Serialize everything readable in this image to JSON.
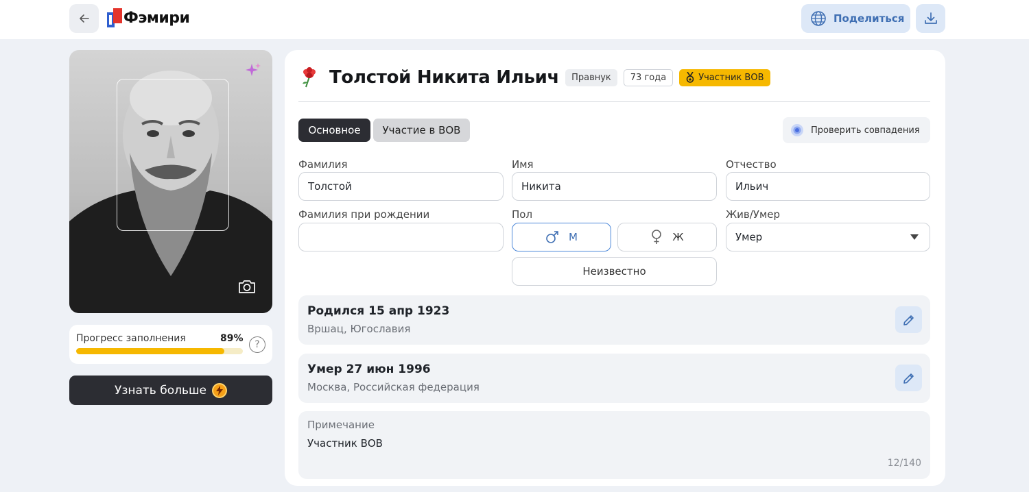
{
  "header": {
    "logo_text": "Фэмири",
    "share_label": "Поделиться",
    "icons": {
      "back": "arrow-left-icon",
      "share": "globe-icon",
      "download": "download-icon"
    }
  },
  "profile": {
    "name": "Толстой Никита Ильич",
    "relation": "Правнук",
    "age": "73 года",
    "vov_badge": "Участник ВОВ"
  },
  "progress": {
    "label": "Прогресс заполнения",
    "value_text": "89%",
    "value": 0.89
  },
  "learn_more": {
    "label": "Узнать больше"
  },
  "tabs": [
    {
      "label": "Основное",
      "active": true
    },
    {
      "label": "Участие в ВОВ",
      "active": false
    }
  ],
  "check_matches": {
    "label": "Проверить совпадения"
  },
  "fields": {
    "surname": {
      "label": "Фамилия",
      "value": "Толстой"
    },
    "first_name": {
      "label": "Имя",
      "value": "Никита"
    },
    "patronymic": {
      "label": "Отчество",
      "value": "Ильич"
    },
    "birth_surname": {
      "label": "Фамилия при рождении",
      "value": ""
    },
    "gender": {
      "label": "Пол",
      "male": "М",
      "female": "Ж",
      "unknown": "Неизвестно",
      "selected": "male"
    },
    "alive_status": {
      "label": "Жив/Умер",
      "value": "Умер"
    }
  },
  "events": {
    "birth": {
      "title": "Родился 15 апр 1923",
      "place": "Вршац, Югославия"
    },
    "death": {
      "title": "Умер 27 июн 1996",
      "place": "Москва, Российская федерация"
    }
  },
  "note": {
    "label": "Примечание",
    "text": "Участник ВОВ",
    "counter": "12/140"
  },
  "colors": {
    "accent_blue": "#3f6fb3",
    "accent_yellow": "#f6b800",
    "dark_button": "#2c2d33",
    "background": "#eef1f6"
  }
}
